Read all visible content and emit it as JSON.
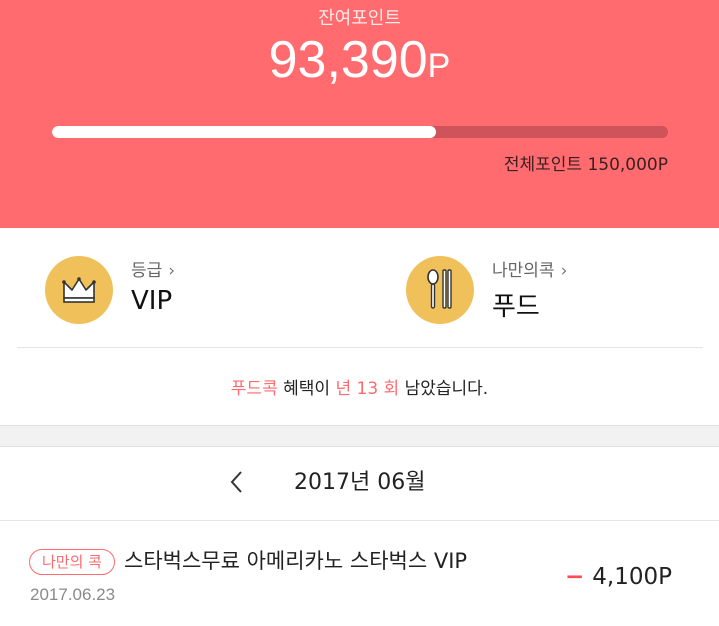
{
  "points": {
    "label": "잔여포인트",
    "value": "93,390",
    "unit": "P",
    "progress": 0.623,
    "total_text": "전체포인트 150,000P"
  },
  "cards": {
    "grade": {
      "title": "등급",
      "value": "VIP",
      "icon": "crown-icon"
    },
    "kong": {
      "title": "나만의콕",
      "value": "푸드",
      "icon": "spoon-chopsticks-icon"
    }
  },
  "benefit": {
    "prefix": "푸드콕",
    "mid": " 혜택이 ",
    "count": "년 13 회",
    "suffix": " 남았습니다."
  },
  "month_nav": {
    "label": "2017년 06월"
  },
  "transactions": [
    {
      "badge": "나만의 콕",
      "title": "스타벅스무료 아메리카노 스타벅스 VIP",
      "date": "2017.06.23",
      "amount": "4,100P",
      "sign": "−"
    }
  ],
  "colors": {
    "accent": "#ff6b6f",
    "bar_bg": "#cf535a",
    "icon_circle": "#f0c15b"
  }
}
